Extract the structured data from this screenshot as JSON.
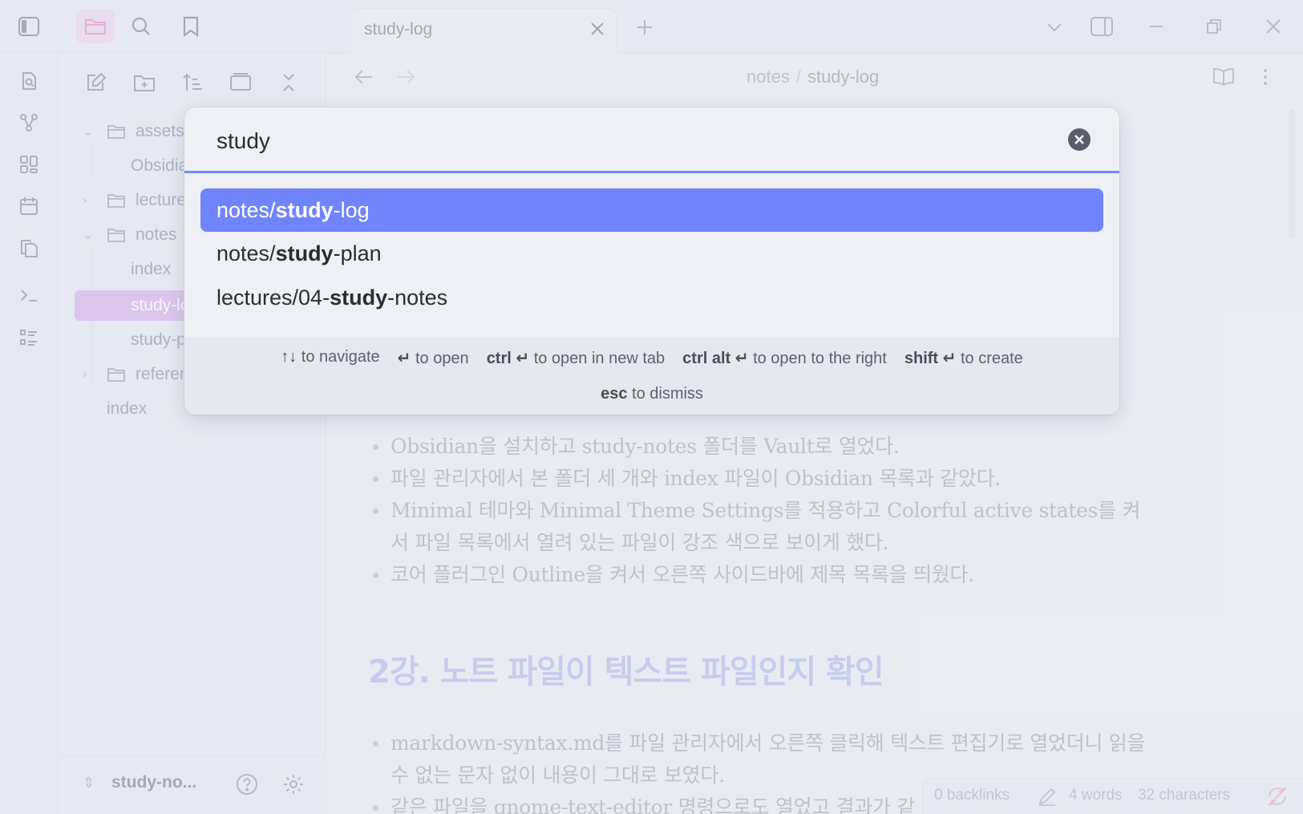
{
  "sidebar_header": {
    "buttons": [
      "toggle-sidebar",
      "files",
      "search",
      "bookmarks"
    ]
  },
  "ribbon": {
    "icons": [
      "open-quick-switcher-icon",
      "graph-view-icon",
      "canvas-icon",
      "daily-note-icon",
      "templates-icon",
      "command-palette-icon",
      "outline-icon"
    ]
  },
  "explorer": {
    "tree": [
      {
        "label": "assets",
        "type": "folder",
        "expanded": true
      },
      {
        "label": "Obsidian",
        "type": "file"
      },
      {
        "label": "lectures",
        "type": "folder",
        "expanded": false
      },
      {
        "label": "notes",
        "type": "folder",
        "expanded": true
      },
      {
        "label": "index",
        "type": "file"
      },
      {
        "label": "study-log",
        "type": "file",
        "active": true
      },
      {
        "label": "study-plan",
        "type": "file"
      },
      {
        "label": "references",
        "type": "folder",
        "expanded": false
      },
      {
        "label": "index",
        "type": "file"
      }
    ],
    "vault_name": "study-no..."
  },
  "tabs": [
    {
      "label": "study-log",
      "active": true
    }
  ],
  "editor": {
    "breadcrumb": {
      "folder": "notes",
      "separator": "/",
      "file": "study-log"
    },
    "bullets_1": [
      "Obsidian을 설치하고 study-notes 폴더를 Vault로 열었다.",
      "파일 관리자에서 본 폴더 세 개와 index 파일이 Obsidian 목록과 같았다.",
      "Minimal 테마와 Minimal Theme Settings를 적용하고 Colorful active states를 켜서 파일 목록에서 열려 있는 파일이 강조 색으로 보이게 했다.",
      "코어 플러그인 Outline을 켜서 오른쪽 사이드바에 제목 목록을 띄웠다."
    ],
    "heading_2": "2강. 노트 파일이 텍스트 파일인지 확인",
    "bullets_2": [
      "markdown-syntax.md를 파일 관리자에서 오른쪽 클릭해 텍스트 편집기로 열었더니 읽을 수 없는 문자 없이 내용이 그대로 보였다.",
      "같은 파일을 gnome-text-editor 명령으로도 열었고 결과가 같"
    ]
  },
  "status_bar": {
    "backlinks": "0 backlinks",
    "words": "4 words",
    "characters": "32 characters"
  },
  "quick_switcher": {
    "query": "study",
    "results": [
      {
        "prefix": "notes/",
        "match": "study",
        "suffix": "-log",
        "selected": true
      },
      {
        "prefix": "notes/",
        "match": "study",
        "suffix": "-plan",
        "selected": false
      },
      {
        "prefix": "lectures/04-",
        "match": "study",
        "suffix": "-notes",
        "selected": false
      }
    ],
    "instructions": [
      {
        "key": "↑↓",
        "text": "to navigate"
      },
      {
        "key": "↵",
        "text": "to open"
      },
      {
        "key": "ctrl ↵",
        "text": "to open in new tab"
      },
      {
        "key": "ctrl alt ↵",
        "text": "to open to the right"
      },
      {
        "key": "shift ↵",
        "text": "to create"
      },
      {
        "key": "esc",
        "text": "to dismiss"
      }
    ]
  },
  "colors": {
    "accent": "#7084fb",
    "active_file": "#cfa6e6",
    "heading": "#a9b2e6"
  }
}
